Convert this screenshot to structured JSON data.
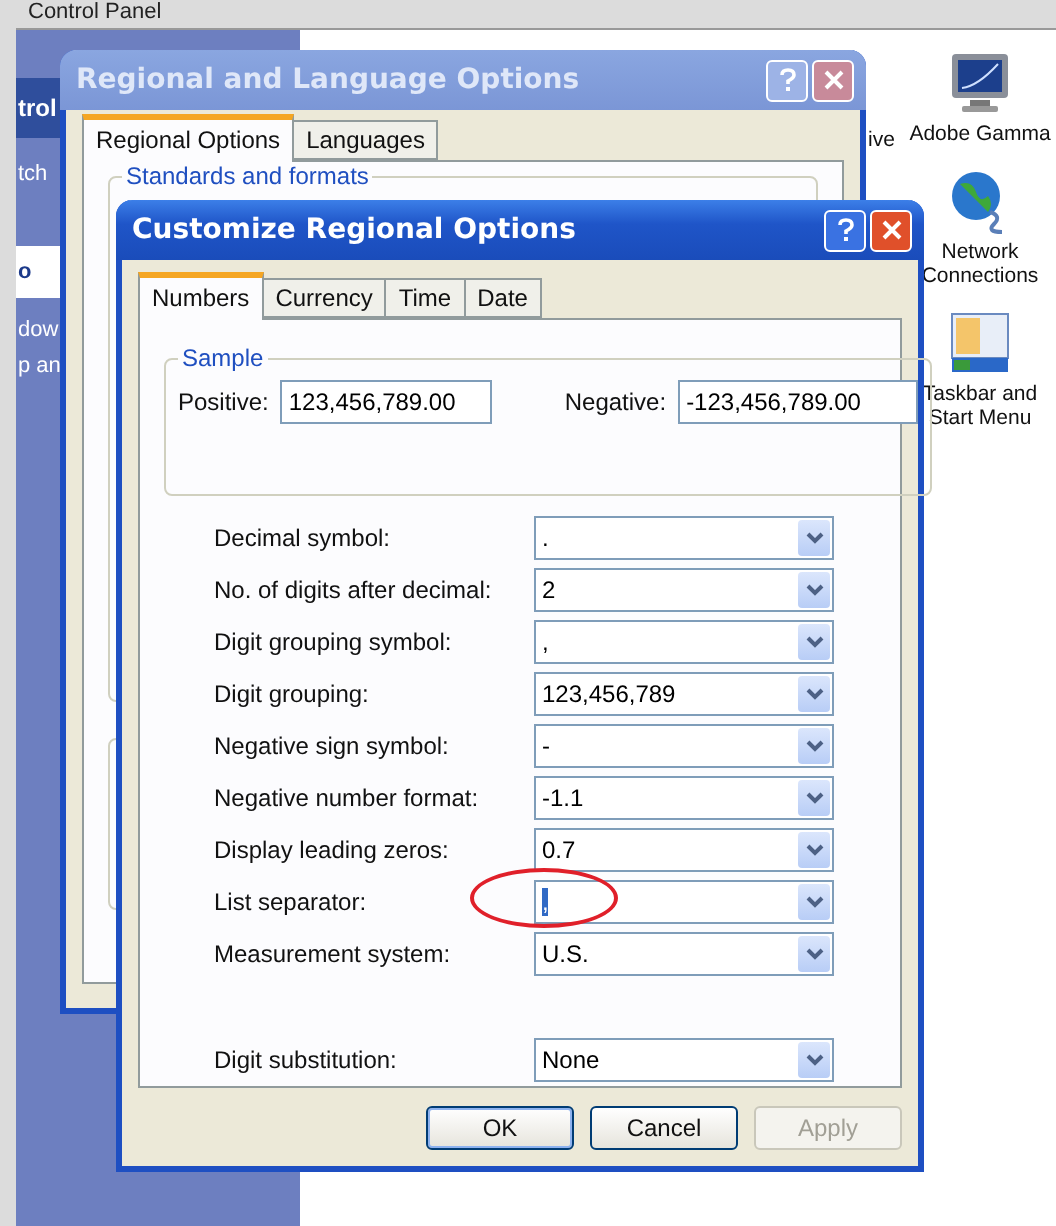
{
  "control_panel": {
    "title": "Control Panel",
    "sidebar": [
      {
        "kind": "title",
        "text": "trol"
      },
      {
        "kind": "link",
        "text": "tch"
      },
      {
        "kind": "header",
        "text": "o"
      },
      {
        "kind": "text",
        "text": "dow"
      },
      {
        "kind": "text",
        "text": "p an"
      }
    ],
    "icons": [
      {
        "kind": "none",
        "label": "ive"
      },
      {
        "kind": "monitor",
        "label": "Adobe Gamma"
      },
      {
        "kind": "globe",
        "label": "Network Connections"
      },
      {
        "kind": "taskbar",
        "label": "Taskbar and Start Menu"
      }
    ]
  },
  "outer_dialog": {
    "title": "Regional and Language Options",
    "tabs": [
      {
        "label": "Regional Options",
        "selected": true
      },
      {
        "label": "Languages",
        "selected": false
      }
    ],
    "group_title": "Standards and formats"
  },
  "dialog": {
    "title": "Customize Regional Options",
    "tabs": [
      {
        "label": "Numbers",
        "selected": true
      },
      {
        "label": "Currency",
        "selected": false
      },
      {
        "label": "Time",
        "selected": false
      },
      {
        "label": "Date",
        "selected": false
      }
    ],
    "sample": {
      "title": "Sample",
      "positive_label": "Positive:",
      "positive_value": "123,456,789.00",
      "negative_label": "Negative:",
      "negative_value": "-123,456,789.00"
    },
    "settings": [
      {
        "label": "Decimal symbol:",
        "value": ".",
        "text_selected": false,
        "circled": false
      },
      {
        "label": "No. of digits after decimal:",
        "value": "2",
        "text_selected": false,
        "circled": false
      },
      {
        "label": "Digit grouping symbol:",
        "value": ",",
        "text_selected": false,
        "circled": false
      },
      {
        "label": "Digit grouping:",
        "value": "123,456,789",
        "text_selected": false,
        "circled": false
      },
      {
        "label": "Negative sign symbol:",
        "value": "-",
        "text_selected": false,
        "circled": false
      },
      {
        "label": "Negative number format:",
        "value": "-1.1",
        "text_selected": false,
        "circled": false
      },
      {
        "label": "Display leading zeros:",
        "value": "0.7",
        "text_selected": false,
        "circled": false
      },
      {
        "label": "List separator:",
        "value": ",",
        "text_selected": true,
        "circled": true
      },
      {
        "label": "Measurement system:",
        "value": "U.S.",
        "text_selected": false,
        "circled": false
      }
    ],
    "extra_settings": [
      {
        "label": "Digit substitution:",
        "value": "None",
        "text_selected": false,
        "circled": false
      }
    ],
    "buttons": [
      {
        "label": "OK",
        "default": true,
        "disabled": false
      },
      {
        "label": "Cancel",
        "default": false,
        "disabled": false
      },
      {
        "label": "Apply",
        "default": false,
        "disabled": true
      }
    ]
  }
}
